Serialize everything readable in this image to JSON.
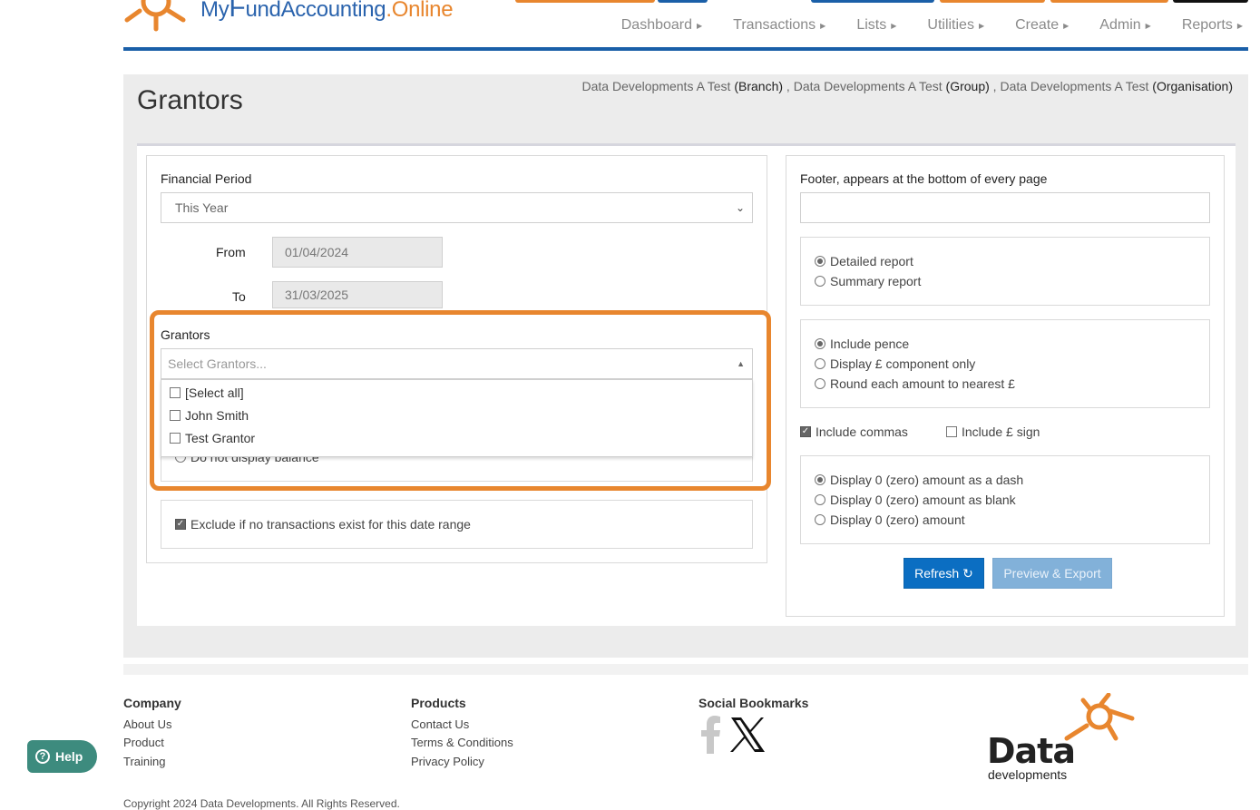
{
  "brand": {
    "logo_my": "My",
    "logo_f": "F",
    "logo_rest": "undAccounting",
    "logo_online": ".Online",
    "colors": {
      "blue": "#2a63ad",
      "orange": "#e8862e",
      "highlight": "#e8862e"
    }
  },
  "nav": [
    {
      "label": "Dashboard"
    },
    {
      "label": "Transactions"
    },
    {
      "label": "Lists"
    },
    {
      "label": "Utilities"
    },
    {
      "label": "Create"
    },
    {
      "label": "Admin"
    },
    {
      "label": "Reports"
    }
  ],
  "page": {
    "title": "Grantors",
    "breadcrumb": {
      "branch_name": "Data Developments A Test",
      "branch_type": "(Branch)",
      "group_name": "Data Developments A Test",
      "group_type": "(Group)",
      "org_name": "Data Developments A Test",
      "org_type": "(Organisation)",
      "sep": ","
    }
  },
  "left": {
    "financial_period_label": "Financial Period",
    "financial_period_value": "This Year",
    "from_label": "From",
    "from_value": "01/04/2024",
    "to_label": "To",
    "to_value": "31/03/2025",
    "grantors_label": "Grantors",
    "grantors_placeholder": "Select Grantors...",
    "grantors_options": [
      {
        "label": "[Select all]",
        "checked": false
      },
      {
        "label": "John Smith",
        "checked": false
      },
      {
        "label": "Test Grantor",
        "checked": false
      }
    ],
    "hidden_radio_label": "Do not display balance",
    "exclude_label": "Exclude if no transactions exist for this date range",
    "exclude_checked": true
  },
  "right": {
    "footer_label": "Footer, appears at the bottom of every page",
    "footer_value": "",
    "report_type": [
      {
        "label": "Detailed report",
        "selected": true
      },
      {
        "label": "Summary report",
        "selected": false
      }
    ],
    "pence_options": [
      {
        "label": "Include pence",
        "selected": true
      },
      {
        "label": "Display £ component only",
        "selected": false
      },
      {
        "label": "Round each amount to nearest £",
        "selected": false
      }
    ],
    "include_commas_label": "Include commas",
    "include_commas_checked": true,
    "include_pound_label": "Include £ sign",
    "include_pound_checked": false,
    "zero_options": [
      {
        "label": "Display 0 (zero) amount as a dash",
        "selected": true
      },
      {
        "label": "Display 0 (zero) amount as blank",
        "selected": false
      },
      {
        "label": "Display 0 (zero) amount",
        "selected": false
      }
    ],
    "refresh_label": "Refresh",
    "preview_label": "Preview & Export"
  },
  "footer": {
    "company_heading": "Company",
    "company_links": [
      "About Us",
      "Product",
      "Training"
    ],
    "products_heading": "Products",
    "products_links": [
      "Contact Us",
      "Terms & Conditions",
      "Privacy Policy"
    ],
    "social_heading": "Social Bookmarks",
    "social_icons": [
      "facebook-icon",
      "x-icon"
    ],
    "help_label": "Help",
    "company_logo_word": "Data",
    "company_logo_sub": "developments",
    "copyright": "Copyright 2024 Data Developments. All Rights Reserved."
  }
}
